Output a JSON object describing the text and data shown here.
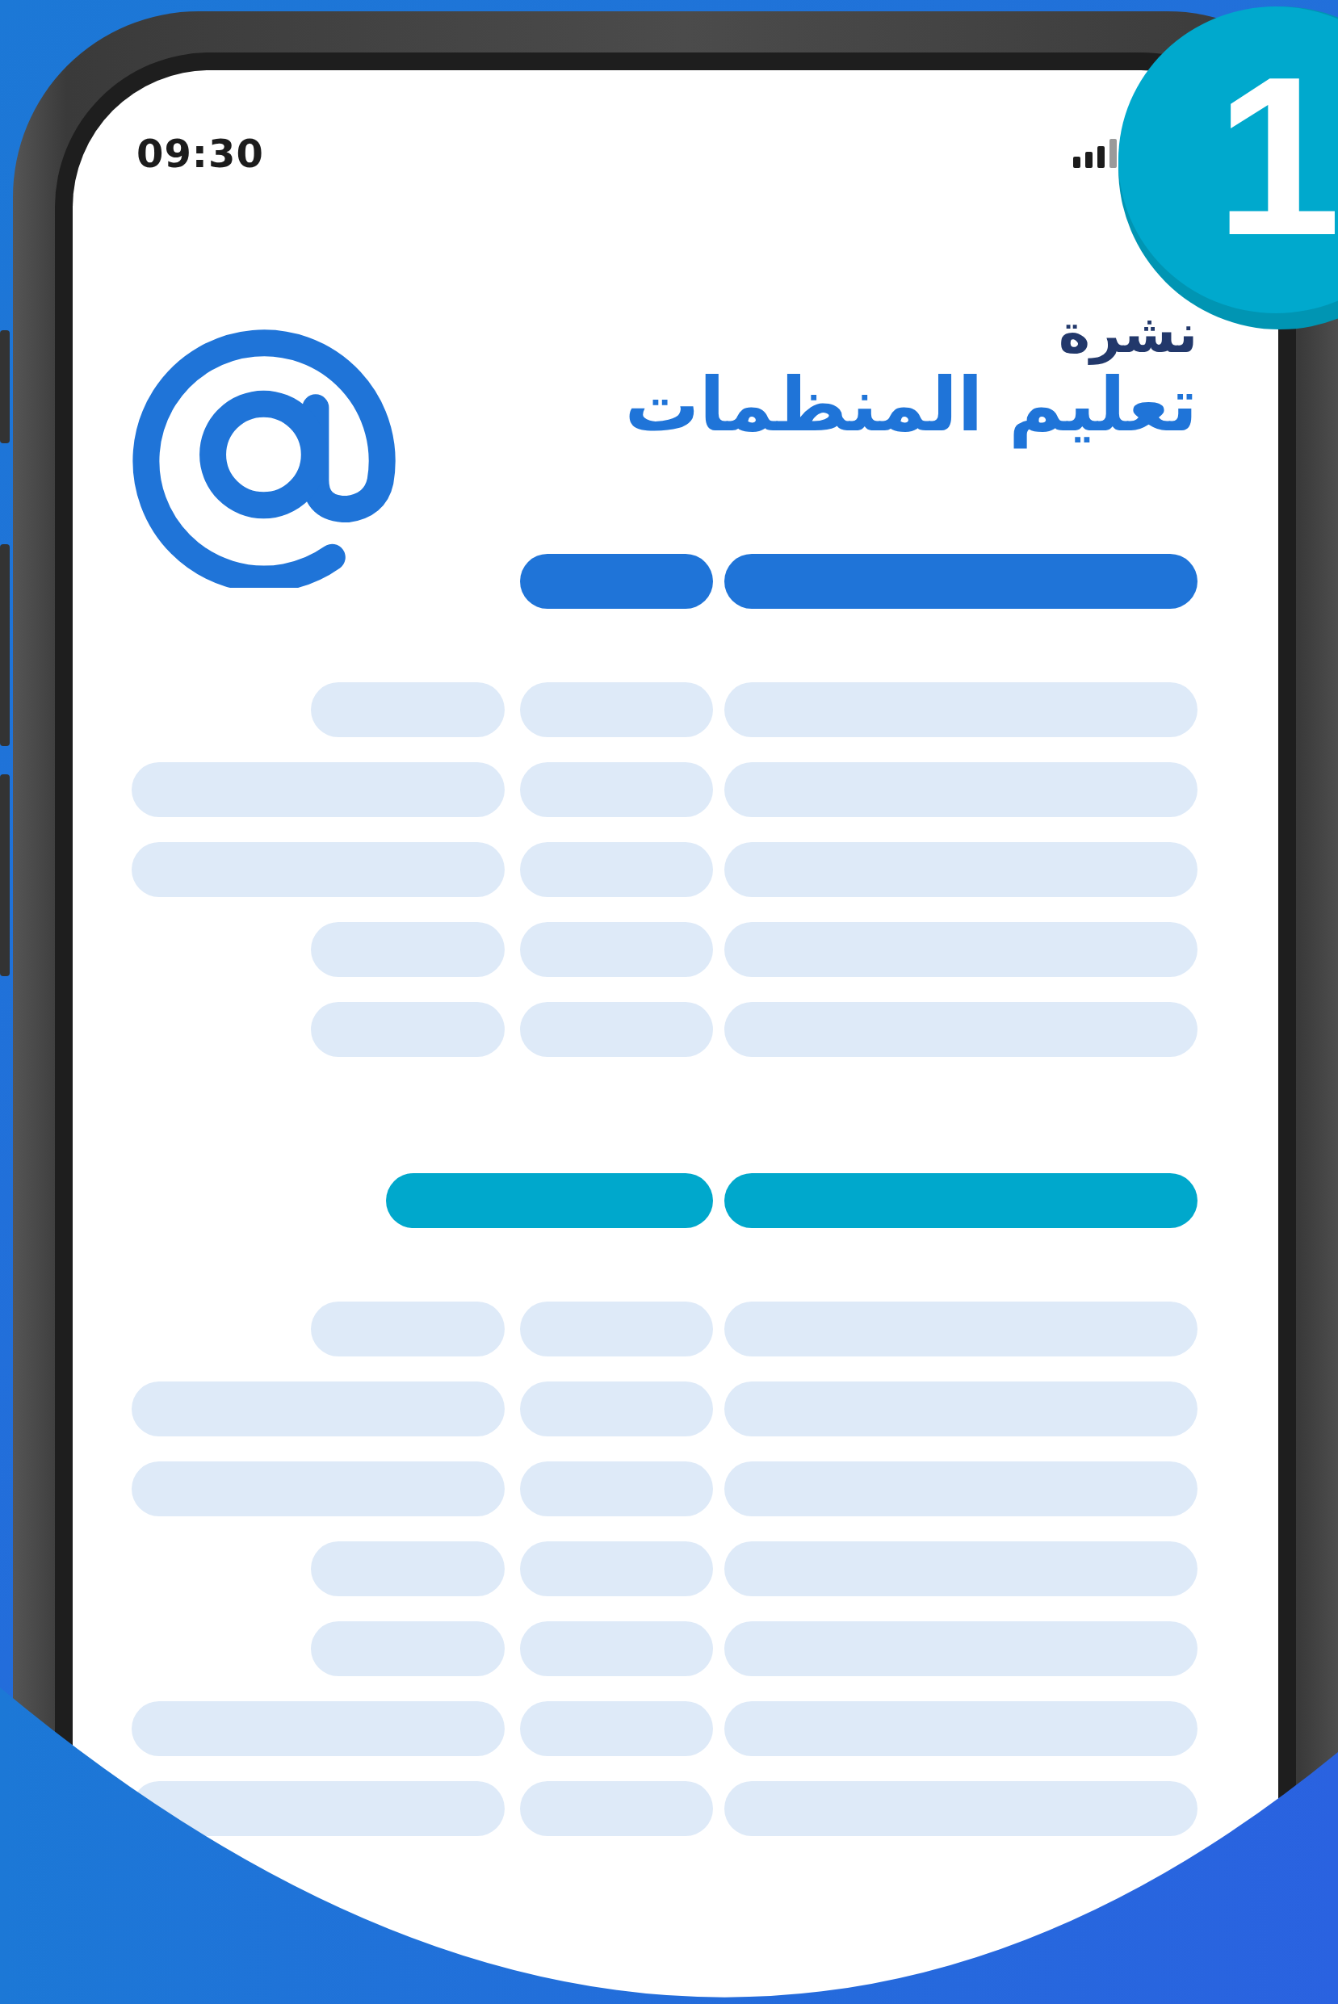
{
  "status_bar": {
    "time": "09:30"
  },
  "badge": {
    "number": "1"
  },
  "newsletter": {
    "kicker": "نشرة",
    "title": "تعليم المنظمات"
  }
}
